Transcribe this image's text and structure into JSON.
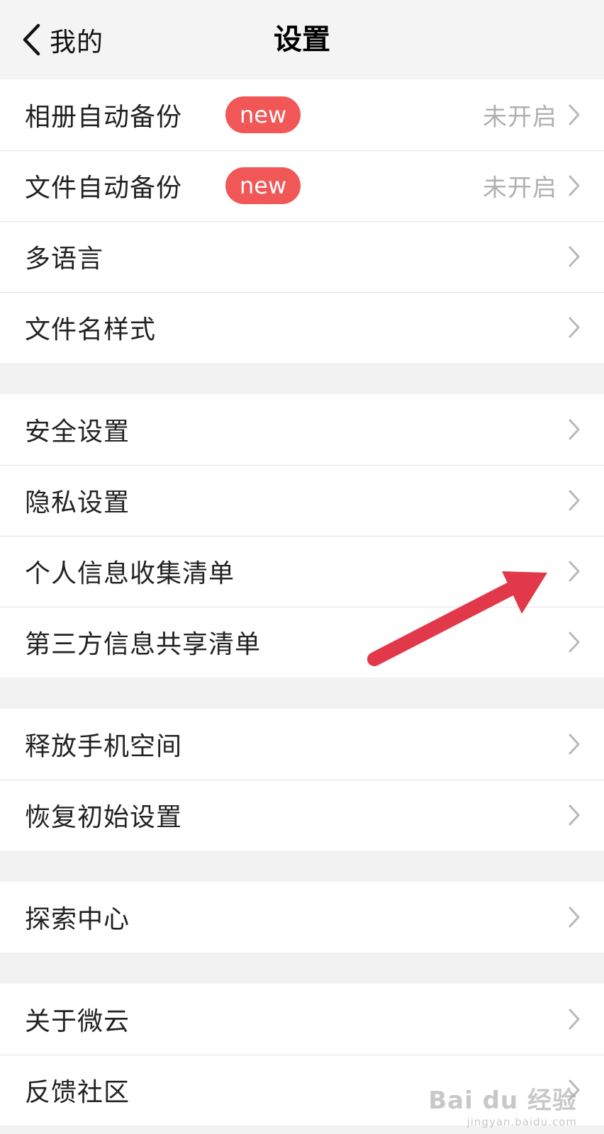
{
  "header": {
    "back_label": "我的",
    "title": "设置"
  },
  "groups": [
    {
      "items": [
        {
          "label": "相册自动备份",
          "badge": "new",
          "value": "未开启"
        },
        {
          "label": "文件自动备份",
          "badge": "new",
          "value": "未开启"
        },
        {
          "label": "多语言"
        },
        {
          "label": "文件名样式"
        }
      ]
    },
    {
      "items": [
        {
          "label": "安全设置"
        },
        {
          "label": "隐私设置"
        },
        {
          "label": "个人信息收集清单"
        },
        {
          "label": "第三方信息共享清单"
        }
      ]
    },
    {
      "items": [
        {
          "label": "释放手机空间"
        },
        {
          "label": "恢复初始设置"
        }
      ]
    },
    {
      "items": [
        {
          "label": "探索中心"
        }
      ]
    },
    {
      "items": [
        {
          "label": "关于微云"
        },
        {
          "label": "反馈社区"
        }
      ]
    }
  ],
  "watermark": {
    "main": "Bai du 经验",
    "sub": "jingyan.baidu.com"
  },
  "colors": {
    "badge": "#f25758",
    "annotation_arrow": "#e2394a",
    "chevron": "#b8b8b8"
  },
  "icons": {
    "back": "chevron-left-icon",
    "row": "chevron-right-icon"
  }
}
